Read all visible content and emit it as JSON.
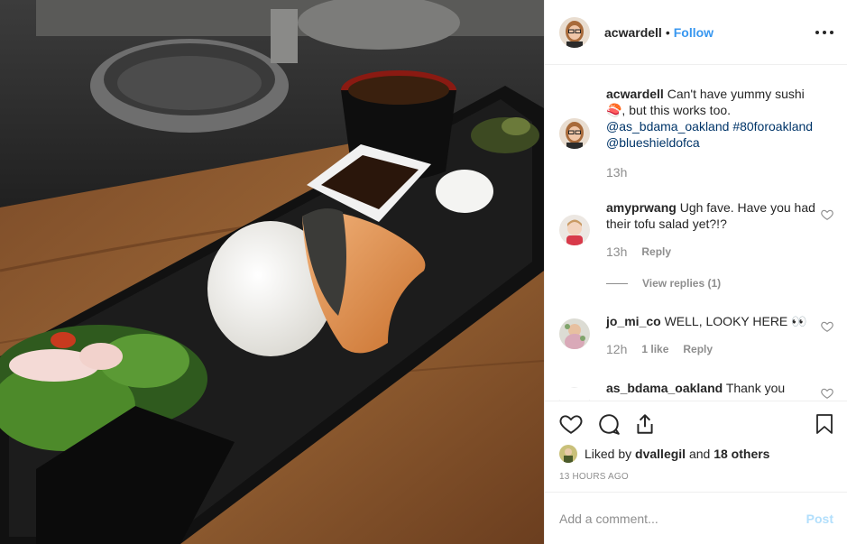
{
  "photo": {
    "alt_icon": "food-photo"
  },
  "header": {
    "username": "acwardell",
    "separator": "•",
    "follow_label": "Follow",
    "more_icon": "more-options-icon"
  },
  "caption": {
    "username": "acwardell",
    "text": "Can't have yummy sushi 🍣, but this works too.",
    "mention1": "@as_bdama_oakland",
    "hashtag": "#80foroakland",
    "mention2": "@blueshieldofca",
    "time": "13h"
  },
  "comments": [
    {
      "username": "amyprwang",
      "text": "Ugh fave. Have you had their tofu salad yet?!?",
      "time": "13h",
      "reply_label": "Reply",
      "view_replies": "View replies (1)"
    },
    {
      "username": "jo_mi_co",
      "text": "WELL, LOOKY HERE 👀",
      "time": "12h",
      "likes": "1 like",
      "reply_label": "Reply"
    },
    {
      "username": "as_bdama_oakland",
      "text": "Thank you"
    }
  ],
  "actions": {
    "liked_prefix": "Liked by",
    "liked_user": "dvallegil",
    "liked_and": "and",
    "liked_others": "18 others",
    "timestamp": "13 HOURS AGO"
  },
  "add_comment": {
    "placeholder": "Add a comment...",
    "post_label": "Post"
  },
  "colors": {
    "link": "#003569",
    "follow": "#3897f0",
    "post_disabled": "#b2dffc",
    "muted": "#8e8e8e"
  }
}
